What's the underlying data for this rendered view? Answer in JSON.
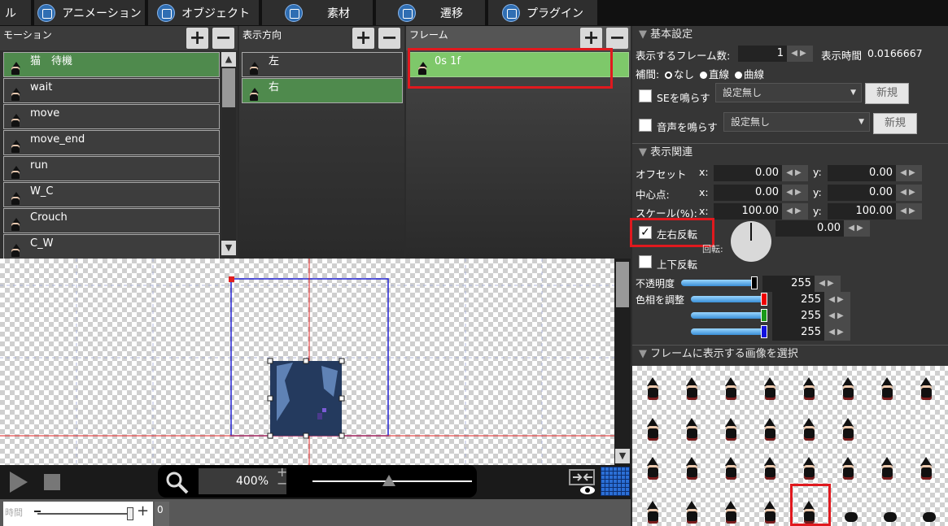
{
  "tabs": [
    {
      "label": "ル",
      "icon": "partial-icon",
      "left": 0
    },
    {
      "label": "アニメーション",
      "icon": "animation-icon"
    },
    {
      "label": "オブジェクト",
      "icon": "object-icon"
    },
    {
      "label": "素材",
      "icon": "material-icon"
    },
    {
      "label": "遷移",
      "icon": "transition-icon"
    },
    {
      "label": "プラグイン",
      "icon": "plugin-icon"
    }
  ],
  "motion": {
    "title": "モーション",
    "items": [
      "猫　待機",
      "wait",
      "move",
      "move_end",
      "run",
      "W_C",
      "Crouch",
      "C_W"
    ],
    "selected": 0
  },
  "direction": {
    "title": "表示方向",
    "items": [
      "左",
      "右"
    ],
    "selected": 1
  },
  "frame": {
    "title": "フレーム",
    "items": [
      "0s 1f"
    ]
  },
  "canvas_toolbar": {
    "zoom": "400%"
  },
  "timeline": {
    "label": "時間",
    "value": "0"
  },
  "basic": {
    "title": "基本設定",
    "frame_count_label": "表示するフレーム数:",
    "frame_count": "1",
    "display_time_label": "表示時間",
    "display_time": "0.0166667",
    "interp_label": "補間:",
    "interp_none": "なし",
    "interp_linear": "直線",
    "interp_curve": "曲線",
    "se_label": "SEを鳴らす",
    "se_value": "設定無し",
    "se_new": "新規",
    "voice_label": "音声を鳴らす",
    "voice_value": "設定無し",
    "voice_new": "新規"
  },
  "display": {
    "title": "表示関連",
    "offset_label": "オフセット",
    "offset_x": "0.00",
    "offset_y": "0.00",
    "center_label": "中心点:",
    "center_x": "0.00",
    "center_y": "0.00",
    "scale_label": "スケール(%):",
    "scale_x": "100.00",
    "scale_y": "100.00",
    "x_label": "x:",
    "y_label": "y:",
    "flip_h_label": "左右反転",
    "flip_h_checked": true,
    "flip_v_label": "上下反転",
    "rotation_label": "回転:",
    "rotation": "0.00",
    "opacity_label": "不透明度",
    "opacity": "255",
    "hue_label": "色相を調整",
    "hue_r": "255",
    "hue_g": "255",
    "hue_b": "255"
  },
  "images": {
    "title": "フレームに表示する画像を選択"
  },
  "colors": {
    "selected_green": "#4f8a4d",
    "frame_green": "#7ec86a",
    "highlight_red": "#e0191e",
    "accent_blue": "#2f6eb3"
  }
}
